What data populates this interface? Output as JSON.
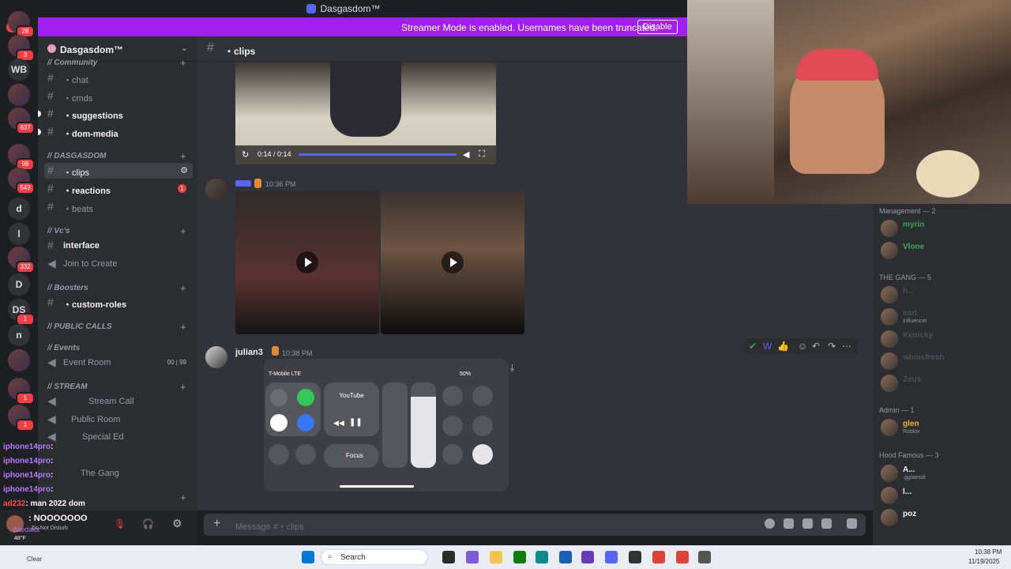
{
  "window": {
    "title": "Dasgasdom™"
  },
  "streamer_banner": {
    "message": "Streamer Mode is enabled. Usernames have been truncated.",
    "button": "Disable"
  },
  "rail": {
    "new_badge": "NEW",
    "items": [
      {
        "label": "",
        "badge": "28"
      },
      {
        "label": "",
        "badge": "3"
      },
      {
        "label": "WB",
        "badge": ""
      },
      {
        "label": "",
        "badge": ""
      },
      {
        "label": "",
        "badge": "637"
      },
      {
        "label": "",
        "badge": "98"
      },
      {
        "label": "",
        "badge": "543"
      },
      {
        "label": "d",
        "badge": ""
      },
      {
        "label": "l",
        "badge": ""
      },
      {
        "label": "",
        "badge": "332"
      },
      {
        "label": "D",
        "badge": ""
      },
      {
        "label": "DS",
        "badge": "1"
      },
      {
        "label": "n",
        "badge": ""
      },
      {
        "label": "",
        "badge": ""
      },
      {
        "label": "",
        "badge": "1"
      },
      {
        "label": "",
        "badge": "1"
      }
    ]
  },
  "server": {
    "name": "Dasgasdom™"
  },
  "sidebar": {
    "categories": [
      {
        "label": "// Community"
      },
      {
        "label": "// DASGASDOM"
      },
      {
        "label": "// Vc's"
      },
      {
        "label": "// Boosters"
      },
      {
        "label": "// PUBLIC CALLS"
      },
      {
        "label": "// Events"
      },
      {
        "label": "// STREAM"
      }
    ],
    "channels": [
      {
        "label": "・chat"
      },
      {
        "label": "・cmds"
      },
      {
        "label": "・suggestions"
      },
      {
        "label": "・dom-media"
      },
      {
        "label": "・clips"
      },
      {
        "label": "・reactions",
        "badge": "1"
      },
      {
        "label": "・beats"
      },
      {
        "label": "interface"
      },
      {
        "label": "Join to Create"
      },
      {
        "label": "・custom-roles"
      },
      {
        "label": "Event Room",
        "counts": "00 | 99"
      },
      {
        "label": "Stream Call"
      },
      {
        "label": "Public Room"
      },
      {
        "label": "Special Ed"
      },
      {
        "label": "The Gang"
      }
    ]
  },
  "chat": {
    "channel": "・clips",
    "video1": {
      "time": "0:14 / 0:14"
    },
    "msg2": {
      "time": "10:36 PM"
    },
    "msg3": {
      "author": "julian3",
      "time": "10:38 PM"
    },
    "phone": {
      "carrier": "T-Mobile LTE",
      "battery": "50%",
      "media_app": "YouTube",
      "focus": "Focus"
    },
    "composer_placeholder": "Message #・clips"
  },
  "members": {
    "groups": [
      {
        "title": "Management — 2"
      },
      {
        "title": "THE GANG — 5"
      },
      {
        "title": "Admin — 1"
      },
      {
        "title": "Hood Famous — 3"
      }
    ],
    "rows": [
      {
        "name": "myrin",
        "status": "",
        "color": "#3ba55d"
      },
      {
        "name": "Vlone",
        "status": "",
        "color": "#3ba55d"
      },
      {
        "name": "h...",
        "status": "",
        "color": "#949ba4"
      },
      {
        "name": "earl",
        "status": "Influencer",
        "color": "#ed4245"
      },
      {
        "name": "Kenicky",
        "status": "",
        "color": "#949ba4"
      },
      {
        "name": "whoisfresh",
        "status": "",
        "color": "#949ba4"
      },
      {
        "name": "Zeus",
        "status": "",
        "color": "#949ba4"
      },
      {
        "name": "glen",
        "status": "Roblox",
        "color": "#f0b232"
      },
      {
        "name": "A...",
        "status": ".gg/aesdr",
        "color": "#f2f3f5"
      },
      {
        "name": "l...",
        "status": "",
        "color": "#f2f3f5"
      },
      {
        "name": "poz",
        "status": "",
        "color": "#f2f3f5"
      }
    ]
  },
  "overlay_chat": [
    {
      "user": "iphone14pro",
      "text": ":",
      "color": "#b57bff"
    },
    {
      "user": "iphone14pro",
      "text": ":",
      "color": "#b57bff"
    },
    {
      "user": "iphone14pro",
      "text": ":",
      "color": "#b57bff"
    },
    {
      "user": "iphone14pro",
      "text": ":",
      "color": "#b57bff"
    },
    {
      "user": "ad232",
      "text": ": man 2022 dom",
      "color": "#ff4d4d"
    },
    {
      "user": "",
      "text": ": NOOOOOOO",
      "color": "#4d8bff"
    }
  ],
  "user_panel": {
    "name": "daedalor",
    "status": "Do Not Disturb"
  },
  "weather": {
    "temp": "48°F",
    "cond": "Clear"
  },
  "taskbar": {
    "search": "Search",
    "time": "10:38 PM",
    "date": "11/19/2025"
  }
}
